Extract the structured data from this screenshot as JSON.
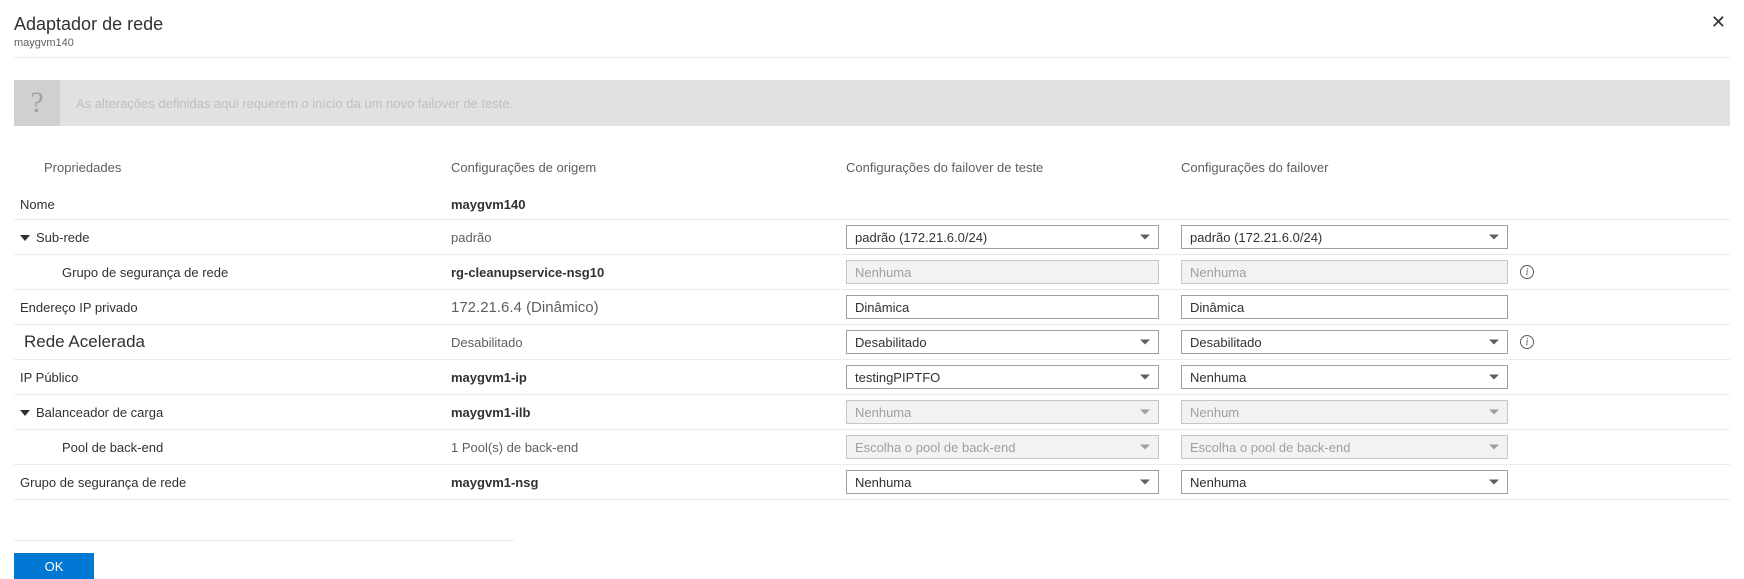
{
  "header": {
    "title": "Adaptador de rede",
    "subtitle": "maygvm140"
  },
  "banner": {
    "icon": "?",
    "text": "As alterações definidas aqui requerem o início da um novo failover de teste."
  },
  "columns": {
    "properties": "Propriedades",
    "source": "Configurações de origem",
    "test_failover": "Configurações do failover de teste",
    "failover": "Configurações do failover"
  },
  "rows": {
    "name": {
      "label": "Nome",
      "src": "maygvm140"
    },
    "subnet": {
      "label": "Sub-rede",
      "src": "padrão",
      "tfo": "padrão (172.21.6.0/24)",
      "fo": "padrão (172.21.6.0/24)"
    },
    "nsg_inner": {
      "label": "Grupo de segurança de rede",
      "src": "rg-cleanupservice-nsg10",
      "tfo": "Nenhuma",
      "fo": "Nenhuma"
    },
    "private_ip": {
      "label": "Endereço IP privado",
      "src": "172.21.6.4 (Dinâmico)",
      "tfo": "Dinâmica",
      "fo": "Dinâmica"
    },
    "accel_net": {
      "label": "Rede Acelerada",
      "src": "Desabilitado",
      "tfo": "Desabilitado",
      "fo": "Desabilitado"
    },
    "public_ip": {
      "label": "IP Público",
      "src": "maygvm1-ip",
      "tfo": "testingPIPTFO",
      "fo": "Nenhuma"
    },
    "lb": {
      "label": "Balanceador de carga",
      "src": "maygvm1-ilb",
      "tfo": "Nenhuma",
      "fo": "Nenhum"
    },
    "backend": {
      "label": "Pool de back-end",
      "src": "1 Pool(s) de back-end",
      "tfo": "Escolha o pool de back-end",
      "fo": "Escolha o pool de back-end"
    },
    "nsg_outer": {
      "label": "Grupo de segurança de rede",
      "src": "maygvm1-nsg",
      "tfo": "Nenhuma",
      "fo": "Nenhuma"
    }
  },
  "buttons": {
    "ok": "OK"
  }
}
